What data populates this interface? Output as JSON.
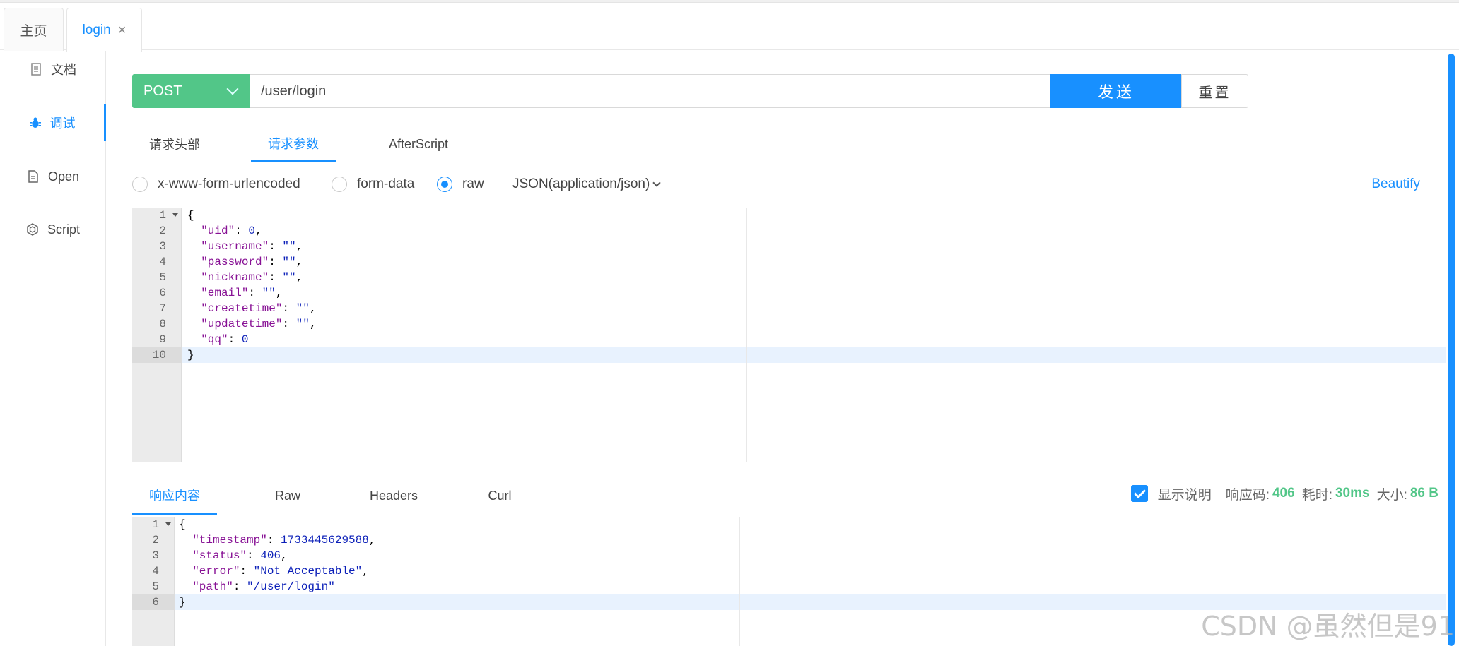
{
  "page_tabs": [
    {
      "label": "主页"
    },
    {
      "label": "login",
      "close": "×"
    }
  ],
  "side_menu": [
    {
      "label": "文档",
      "icon": "document-icon"
    },
    {
      "label": "调试",
      "icon": "bug-icon"
    },
    {
      "label": "Open",
      "icon": "file-icon"
    },
    {
      "label": "Script",
      "icon": "code-icon"
    }
  ],
  "request": {
    "method": "POST",
    "url": "/user/login",
    "send_label": "发送",
    "reset_label": "重置"
  },
  "request_tabs": [
    "请求头部",
    "请求参数",
    "AfterScript"
  ],
  "body_types": {
    "options": [
      "x-www-form-urlencoded",
      "form-data",
      "raw"
    ],
    "selected": "raw",
    "content_type": "JSON(application/json)",
    "beautify_label": "Beautify"
  },
  "request_body": {
    "line_numbers": [
      "1",
      "2",
      "3",
      "4",
      "5",
      "6",
      "7",
      "8",
      "9",
      "10"
    ],
    "lines": [
      {
        "parts": [
          {
            "t": "p",
            "v": "{"
          }
        ]
      },
      {
        "parts": [
          {
            "t": "p",
            "v": "  "
          },
          {
            "t": "k",
            "v": "\"uid\""
          },
          {
            "t": "p",
            "v": ": "
          },
          {
            "t": "n",
            "v": "0"
          },
          {
            "t": "p",
            "v": ","
          }
        ]
      },
      {
        "parts": [
          {
            "t": "p",
            "v": "  "
          },
          {
            "t": "k",
            "v": "\"username\""
          },
          {
            "t": "p",
            "v": ": "
          },
          {
            "t": "s",
            "v": "\"\""
          },
          {
            "t": "p",
            "v": ","
          }
        ]
      },
      {
        "parts": [
          {
            "t": "p",
            "v": "  "
          },
          {
            "t": "k",
            "v": "\"password\""
          },
          {
            "t": "p",
            "v": ": "
          },
          {
            "t": "s",
            "v": "\"\""
          },
          {
            "t": "p",
            "v": ","
          }
        ]
      },
      {
        "parts": [
          {
            "t": "p",
            "v": "  "
          },
          {
            "t": "k",
            "v": "\"nickname\""
          },
          {
            "t": "p",
            "v": ": "
          },
          {
            "t": "s",
            "v": "\"\""
          },
          {
            "t": "p",
            "v": ","
          }
        ]
      },
      {
        "parts": [
          {
            "t": "p",
            "v": "  "
          },
          {
            "t": "k",
            "v": "\"email\""
          },
          {
            "t": "p",
            "v": ": "
          },
          {
            "t": "s",
            "v": "\"\""
          },
          {
            "t": "p",
            "v": ","
          }
        ]
      },
      {
        "parts": [
          {
            "t": "p",
            "v": "  "
          },
          {
            "t": "k",
            "v": "\"createtime\""
          },
          {
            "t": "p",
            "v": ": "
          },
          {
            "t": "s",
            "v": "\"\""
          },
          {
            "t": "p",
            "v": ","
          }
        ]
      },
      {
        "parts": [
          {
            "t": "p",
            "v": "  "
          },
          {
            "t": "k",
            "v": "\"updatetime\""
          },
          {
            "t": "p",
            "v": ": "
          },
          {
            "t": "s",
            "v": "\"\""
          },
          {
            "t": "p",
            "v": ","
          }
        ]
      },
      {
        "parts": [
          {
            "t": "p",
            "v": "  "
          },
          {
            "t": "k",
            "v": "\"qq\""
          },
          {
            "t": "p",
            "v": ": "
          },
          {
            "t": "n",
            "v": "0"
          }
        ]
      },
      {
        "parts": [
          {
            "t": "p",
            "v": "}"
          }
        ]
      }
    ]
  },
  "response_tabs": [
    "响应内容",
    "Raw",
    "Headers",
    "Curl"
  ],
  "response_meta": {
    "show_desc_label": "显示说明",
    "code_label": "响应码:",
    "code_value": "406",
    "time_label": "耗时:",
    "time_value": "30ms",
    "size_label": "大小:",
    "size_value": "86 B"
  },
  "response_body": {
    "line_numbers": [
      "1",
      "2",
      "3",
      "4",
      "5",
      "6"
    ],
    "lines": [
      {
        "parts": [
          {
            "t": "p",
            "v": "{"
          }
        ]
      },
      {
        "parts": [
          {
            "t": "p",
            "v": "  "
          },
          {
            "t": "k",
            "v": "\"timestamp\""
          },
          {
            "t": "p",
            "v": ": "
          },
          {
            "t": "n",
            "v": "1733445629588"
          },
          {
            "t": "p",
            "v": ","
          }
        ]
      },
      {
        "parts": [
          {
            "t": "p",
            "v": "  "
          },
          {
            "t": "k",
            "v": "\"status\""
          },
          {
            "t": "p",
            "v": ": "
          },
          {
            "t": "n",
            "v": "406"
          },
          {
            "t": "p",
            "v": ","
          }
        ]
      },
      {
        "parts": [
          {
            "t": "p",
            "v": "  "
          },
          {
            "t": "k",
            "v": "\"error\""
          },
          {
            "t": "p",
            "v": ": "
          },
          {
            "t": "s",
            "v": "\"Not Acceptable\""
          },
          {
            "t": "p",
            "v": ","
          }
        ]
      },
      {
        "parts": [
          {
            "t": "p",
            "v": "  "
          },
          {
            "t": "k",
            "v": "\"path\""
          },
          {
            "t": "p",
            "v": ": "
          },
          {
            "t": "s",
            "v": "\"/user/login\""
          }
        ]
      },
      {
        "parts": [
          {
            "t": "p",
            "v": "}"
          }
        ]
      }
    ]
  },
  "watermark": "CSDN @虽然但是91"
}
